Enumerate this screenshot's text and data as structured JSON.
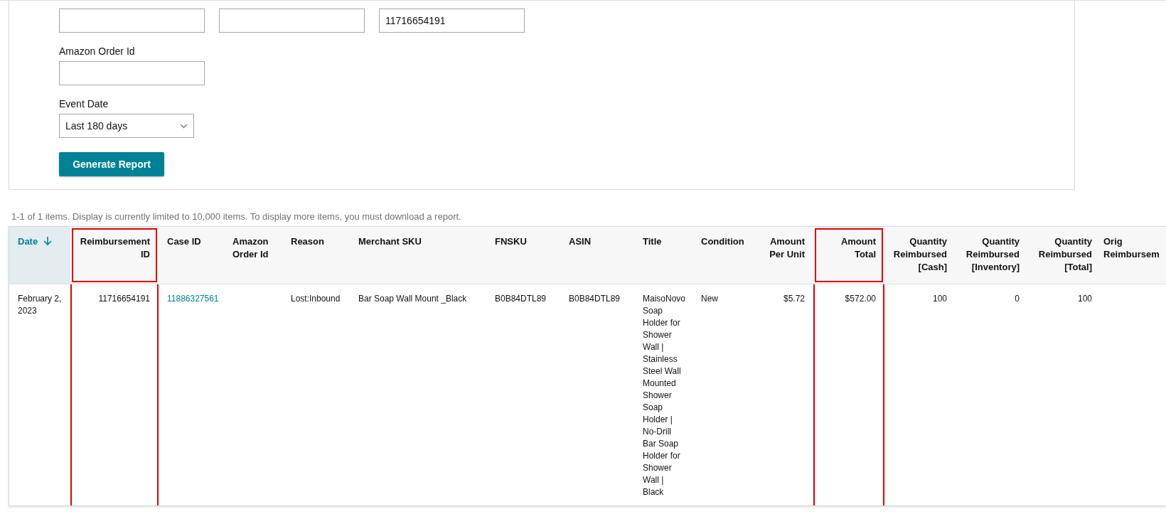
{
  "filters": {
    "top_fields": [
      {
        "kind": "empty"
      },
      {
        "kind": "empty"
      },
      {
        "kind": "filled",
        "value": "11716654191"
      }
    ],
    "order_field": {
      "label": "Amazon Order Id"
    },
    "event_date": {
      "label": "Event Date",
      "value": "Last 180 days"
    },
    "generate_button": "Generate Report"
  },
  "summary": "1-1 of 1 items. Display is currently limited to 10,000 items. To display more items, you must download a report.",
  "table": {
    "columns": [
      {
        "label": "Date",
        "kind": "text",
        "sorted": true,
        "highlighted": false
      },
      {
        "label": "Reimbursement ID",
        "kind": "number",
        "sorted": false,
        "highlighted": true
      },
      {
        "label": "Case ID",
        "kind": "text",
        "sorted": false,
        "highlighted": false
      },
      {
        "label": "Amazon Order Id",
        "kind": "text",
        "sorted": false,
        "highlighted": false
      },
      {
        "label": "Reason",
        "kind": "text",
        "sorted": false,
        "highlighted": false
      },
      {
        "label": "Merchant SKU",
        "kind": "text",
        "sorted": false,
        "highlighted": false
      },
      {
        "label": "FNSKU",
        "kind": "text",
        "sorted": false,
        "highlighted": false
      },
      {
        "label": "ASIN",
        "kind": "text",
        "sorted": false,
        "highlighted": false
      },
      {
        "label": "Title",
        "kind": "text",
        "sorted": false,
        "highlighted": false
      },
      {
        "label": "Condition",
        "kind": "text",
        "sorted": false,
        "highlighted": false
      },
      {
        "label": "Amount Per Unit",
        "kind": "number",
        "sorted": false,
        "highlighted": false
      },
      {
        "label": "Amount Total",
        "kind": "number",
        "sorted": false,
        "highlighted": true
      },
      {
        "label": "Quantity Reimbursed [Cash]",
        "kind": "number",
        "sorted": false,
        "highlighted": false
      },
      {
        "label": "Quantity Reimbursed [Inventory]",
        "kind": "number",
        "sorted": false,
        "highlighted": false
      },
      {
        "label": "Quantity Reimbursed [Total]",
        "kind": "number",
        "sorted": false,
        "highlighted": false
      },
      {
        "label": "Orig Reimbursem",
        "kind": "text",
        "sorted": false,
        "highlighted": false
      }
    ],
    "rows": [
      {
        "cells": [
          {
            "kind": "text",
            "text": "February 2, 2023"
          },
          {
            "kind": "text",
            "text": "11716654191"
          },
          {
            "kind": "link",
            "text": "11886327561"
          },
          {
            "kind": "empty"
          },
          {
            "kind": "text",
            "text": "Lost:Inbound"
          },
          {
            "kind": "text",
            "text": "Bar Soap Wall Mount _Black"
          },
          {
            "kind": "text",
            "text": "B0B84DTL89"
          },
          {
            "kind": "text",
            "text": "B0B84DTL89"
          },
          {
            "kind": "text",
            "text": "MaisoNovo Soap Holder for Shower Wall | Stainless Steel Wall Mounted Shower Soap Holder | No-Drill Bar Soap Holder for Shower Wall | Black"
          },
          {
            "kind": "text",
            "text": "New"
          },
          {
            "kind": "text",
            "text": "$5.72"
          },
          {
            "kind": "text",
            "text": "$572.00"
          },
          {
            "kind": "text",
            "text": "100"
          },
          {
            "kind": "text",
            "text": "0"
          },
          {
            "kind": "text",
            "text": "100"
          },
          {
            "kind": "empty"
          }
        ]
      }
    ]
  }
}
